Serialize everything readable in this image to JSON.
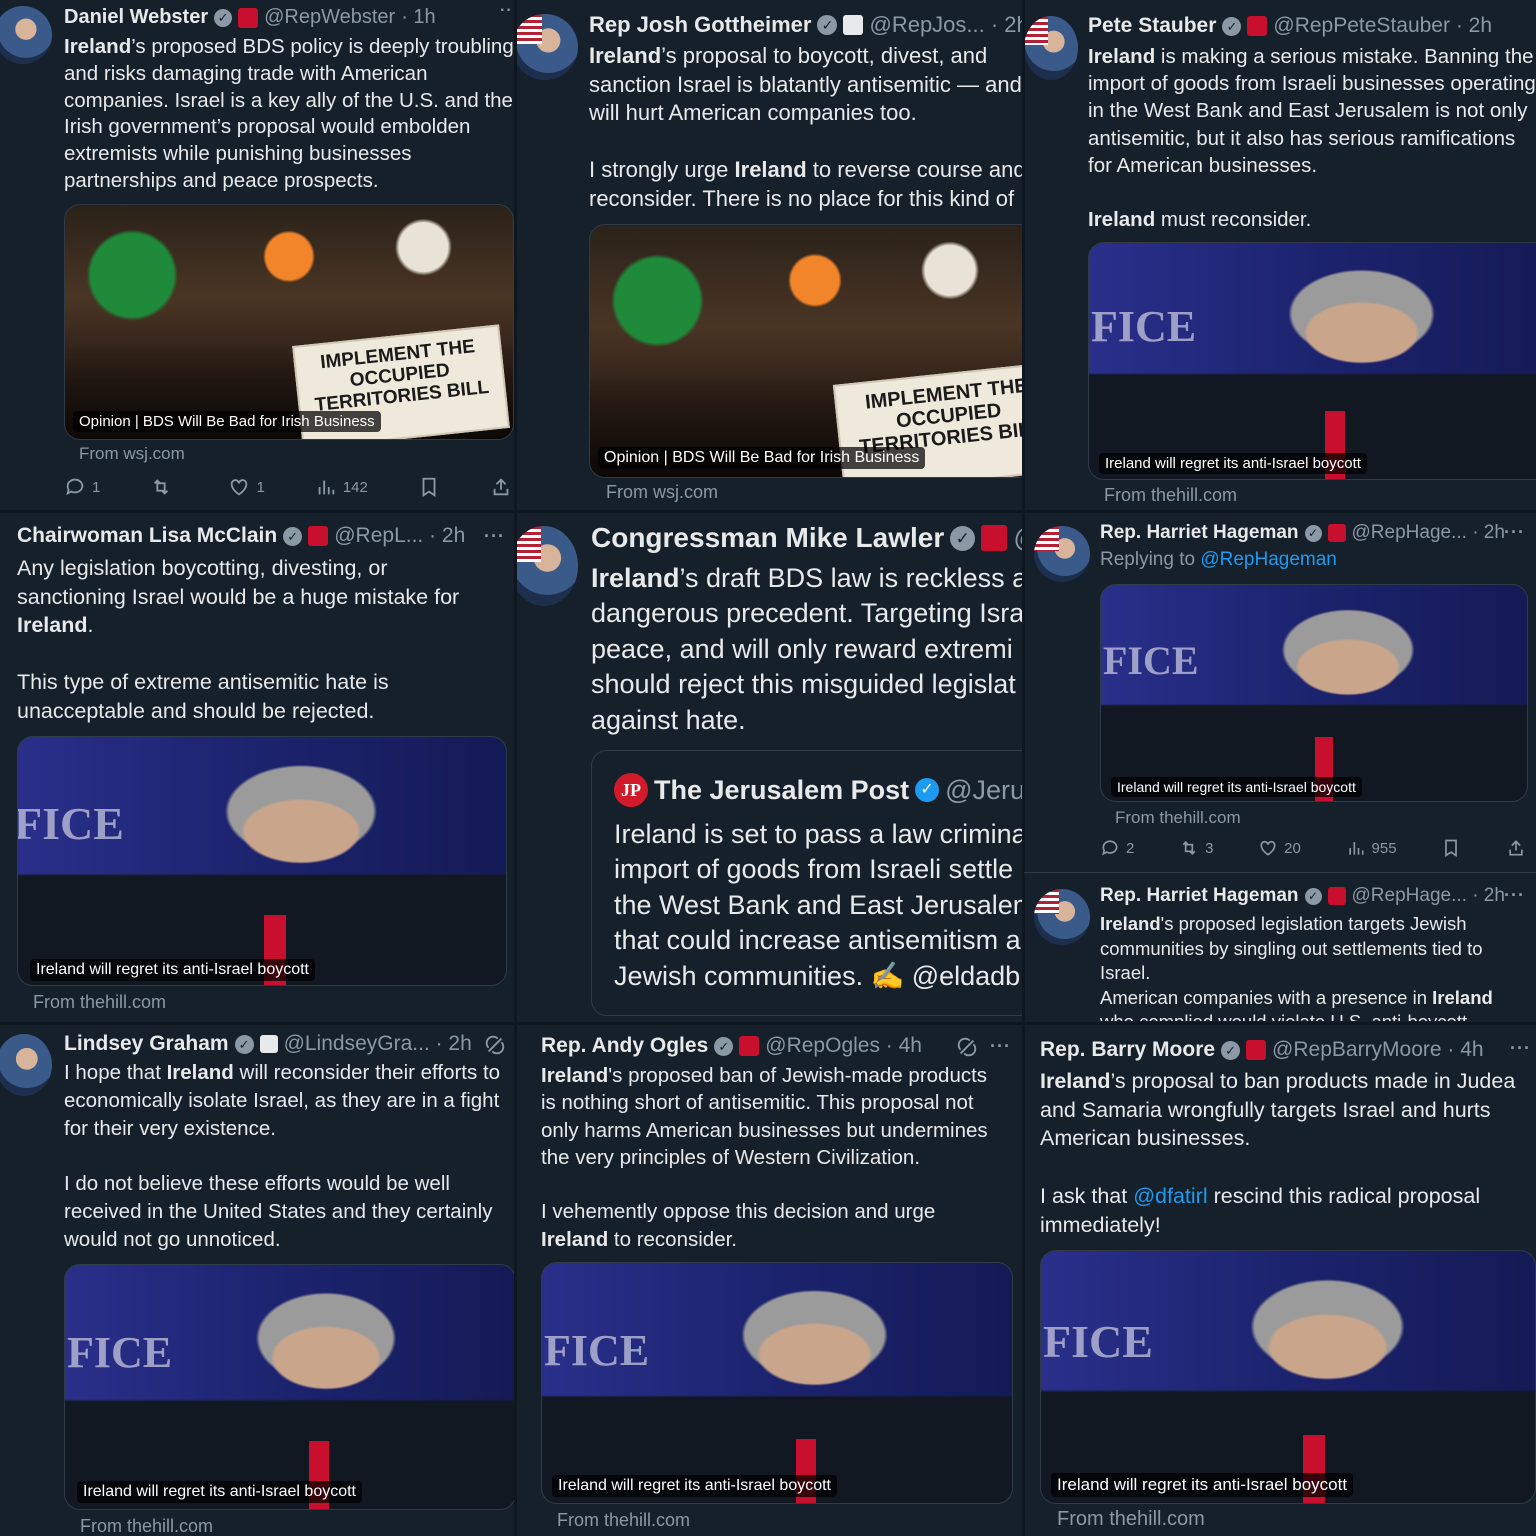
{
  "tweets": {
    "webster": {
      "name": "Daniel Webster",
      "handle": "@RepWebster",
      "time": "· 1h",
      "more": "··",
      "text_parts": [
        "Ireland",
        "’s proposed BDS policy is deeply troubling\nand risks damaging trade with American\ncompanies. Israel is a key ally of the U.S. and the\nIrish government’s proposal would embolden\nextremists while punishing businesses\npartnerships and peace prospects."
      ],
      "sign": "IMPLEMENT THE\nOCCUPIED\nTERRITORIES BILL",
      "caption": "Opinion | BDS Will Be Bad for Irish Business",
      "source": "From wsj.com",
      "replies": "1",
      "reposts": "",
      "likes": "1",
      "views": "142"
    },
    "gottheimer": {
      "name": "Rep Josh Gottheimer",
      "handle": "@RepJos... · 2h",
      "text_parts": [
        "Ireland",
        "’s proposal to boycott, divest, and\nsanction Israel is blatantly antisemitic — and\nwill hurt American companies too.\n\nI strongly urge ",
        "Ireland",
        " to reverse course and\nreconsider. There is no place for this kind of"
      ],
      "sign": "IMPLEMENT THE\nOCCUPIED\nTERRITORIES BILL",
      "caption": "Opinion | BDS Will Be Bad for Irish Business",
      "source": "From wsj.com"
    },
    "stauber": {
      "name": "Pete Stauber",
      "handle": "@RepPeteStauber · 2h",
      "text_parts": [
        "Ireland",
        " is making a serious mistake. Banning the\nimport of goods from Israeli businesses operating\nin the West Bank and East Jerusalem is not only\nantisemitic, but it also has serious ramifications\nfor American businesses.\n\n",
        "Ireland",
        " must reconsider."
      ],
      "image_text": "FICE",
      "caption": "Ireland will regret its anti-Israel boycott",
      "source": "From thehill.com"
    },
    "mcclain": {
      "name": "Chairwoman Lisa McClain",
      "handle": "@RepL... · 2h",
      "more": "···",
      "text_parts": [
        "Any legislation boycotting, divesting, or\nsanctioning Israel would be a huge mistake for\n",
        "Ireland",
        ".\n\nThis type of extreme antisemitic hate is\nunacceptable and should be rejected."
      ],
      "image_text": "FICE",
      "caption": "Ireland will regret its anti-Israel boycott",
      "source": "From thehill.com"
    },
    "lawler": {
      "name": "Congressman Mike Lawler",
      "handle": "@",
      "text_parts": [
        "Ireland",
        "’s draft BDS law is reckless a\ndangerous precedent. Targeting Isra\npeace, and will only reward extremi\nshould reject this misguided legislat\nagainst hate."
      ],
      "quote": {
        "logo": "JP",
        "name": "The Jerusalem Post",
        "handle": "@Jeru",
        "text": "Ireland is set to pass a law crimina\nimport of goods from Israeli settle\nthe West Bank and East Jerusalem\nthat could increase antisemitism a\nJewish communities. ✍️ @eldadb"
      }
    },
    "hageman1": {
      "name": "Rep. Harriet Hageman",
      "handle": "@RepHage... · 2h",
      "more": "···",
      "reply_label": "Replying to",
      "reply_to": "@RepHageman",
      "image_text": "FICE",
      "caption": "Ireland will regret its anti-Israel boycott",
      "source": "From thehill.com",
      "replies": "2",
      "reposts": "3",
      "likes": "20",
      "views": "955"
    },
    "hageman2": {
      "name": "Rep. Harriet Hageman",
      "handle": "@RepHage... · 2h",
      "more": "···",
      "text_parts": [
        "Ireland",
        "'s proposed legislation targets Jewish\ncommunities by singling out settlements tied to\nIsrael.\nAmerican companies with a presence in ",
        "Ireland",
        "\nwho complied would violate U.S. anti-boycott"
      ]
    },
    "graham": {
      "name": "Lindsey Graham",
      "handle": "@LindseyGra... · 2h",
      "text_parts": [
        "I hope that ",
        "Ireland",
        " will reconsider their efforts to\neconomically isolate Israel, as they are in a fight\nfor their very existence.\n\nI do not believe these efforts would be well\nreceived in the United States and they certainly\nwould not go unnoticed."
      ],
      "image_text": "FICE",
      "caption": "Ireland will regret its anti-Israel boycott",
      "source": "From thehill.com"
    },
    "ogles": {
      "name": "Rep. Andy Ogles",
      "handle": "@RepOgles · 4h",
      "more": "···",
      "text_parts": [
        "Ireland",
        "'s proposed ban of Jewish-made products\nis nothing short of antisemitic. This proposal not\nonly harms American businesses but undermines\nthe very principles of Western Civilization.\n\nI vehemently oppose this decision and urge\n",
        "Ireland",
        " to reconsider."
      ],
      "image_text": "FICE",
      "caption": "Ireland will regret its anti-Israel boycott",
      "source": "From thehill.com"
    },
    "moore": {
      "name": "Rep. Barry Moore",
      "handle": "@RepBarryMoore · 4h",
      "more": "···",
      "text_parts": [
        "Ireland",
        "’s proposal to ban products made in Judea\nand Samaria wrongfully targets Israel and hurts\nAmerican businesses.\n\nI ask that ",
        "@dfatirl",
        " rescind this radical proposal\nimmediately!"
      ],
      "image_text": "FICE",
      "caption": "Ireland will regret its anti-Israel boycott",
      "source": "From thehill.com"
    }
  },
  "icons": {
    "verified": "verified-badge-icon",
    "seal": "official-seal-icon",
    "reply": "reply-icon",
    "repost": "repost-icon",
    "like": "like-icon",
    "views": "views-icon",
    "bookmark": "bookmark-icon",
    "share": "share-icon",
    "grok": "grok-icon"
  },
  "colors": {
    "background": "#15202b",
    "text": "#e7e9ea",
    "muted": "#8b98a5",
    "link": "#1d9bf0",
    "verified": "#1d9bf0",
    "seal": "#c8102e"
  }
}
